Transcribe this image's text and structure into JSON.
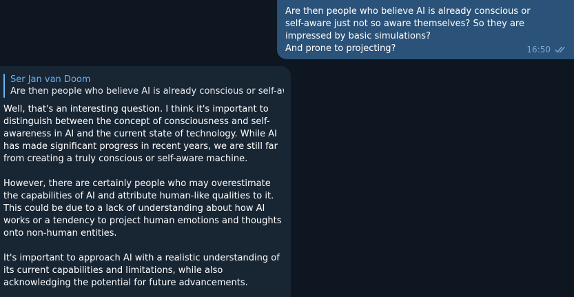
{
  "outgoing": {
    "text": "Are then people who believe AI is already conscious or self-aware just not so aware themselves? So they are impressed by basic simulations?\nAnd prone to projecting?",
    "time": "16:50",
    "status_icon": "double-check-icon"
  },
  "incoming": {
    "reply_name": "Ser Jan van Doom",
    "reply_text": "Are then people who believe AI is already conscious or self-awa...",
    "paragraphs": [
      "Well, that's an interesting question. I think it's important to distinguish between the concept of consciousness and self-awareness in AI and the current state of technology. While AI has made significant progress in recent years, we are still far from creating a truly conscious or self-aware machine.",
      "However, there are certainly people who may overestimate the capabilities of AI and attribute human-like qualities to it. This could be due to a lack of understanding about how AI works or a tendency to project human emotions and thoughts onto non-human entities.",
      "It's important to approach AI with a realistic understanding of its current capabilities and limitations, while also acknowledging the potential for future advancements."
    ]
  },
  "colors": {
    "background": "#0e1621",
    "outgoing_bubble": "#2b5278",
    "incoming_bubble": "#182533",
    "accent": "#6ab3f3"
  }
}
